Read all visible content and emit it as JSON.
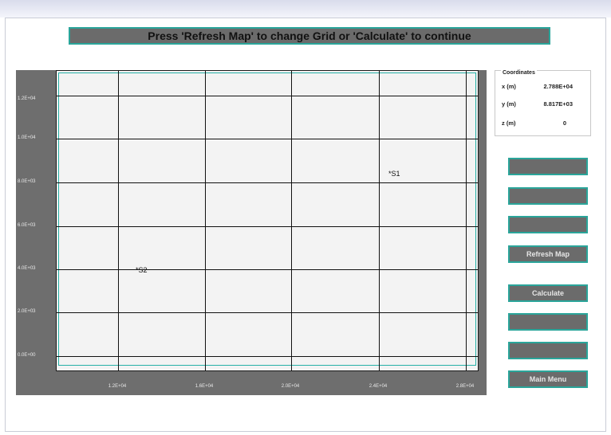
{
  "banner": {
    "text": "Press 'Refresh Map' to change Grid or 'Calculate' to continue"
  },
  "plot": {
    "y_ticks": [
      "1.2E+04",
      "1.0E+04",
      "8.0E+03",
      "6.0E+03",
      "4.0E+03",
      "2.0E+03",
      "0.0E+00"
    ],
    "x_ticks": [
      "1.2E+04",
      "1.6E+04",
      "2.0E+04",
      "2.4E+04",
      "2.8E+04"
    ],
    "sources": [
      {
        "label": "*S1"
      },
      {
        "label": "*S2"
      }
    ],
    "colors": {
      "panel": "#6e6e6e",
      "background": "#f3f3f3",
      "grid": "#111111",
      "frame": "#25b0a6"
    }
  },
  "coordinates": {
    "title": "Coordinates",
    "rows": [
      {
        "label": "x (m)",
        "value": "2.788E+04"
      },
      {
        "label": "y (m)",
        "value": "8.817E+03"
      },
      {
        "label": "z (m)",
        "value": "0"
      }
    ]
  },
  "buttons": [
    {
      "label": ""
    },
    {
      "label": ""
    },
    {
      "label": ""
    },
    {
      "label": "Refresh Map"
    },
    {
      "label": "Calculate"
    },
    {
      "label": ""
    },
    {
      "label": ""
    },
    {
      "label": "Main Menu"
    }
  ],
  "colors": {
    "button": "#6b6b6b",
    "accent": "#2aa59a"
  }
}
